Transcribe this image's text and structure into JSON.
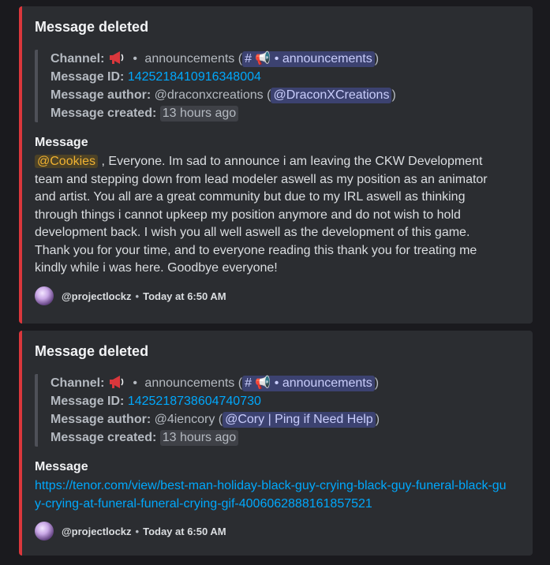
{
  "colors": {
    "accent_bar": "#da373c",
    "embed_bg": "#2b2d31",
    "link": "#00a8fc",
    "mention_bg": "#3c4270"
  },
  "messages": [
    {
      "title": "Message deleted",
      "channel_label": "Channel:",
      "channel_name": "announcements",
      "channel_mention": "announcements",
      "message_id_label": "Message ID:",
      "message_id": "1425218410916348004",
      "author_label": "Message author:",
      "author_username": "@draconxcreations",
      "author_mention": "@DraconXCreations",
      "created_label": "Message created:",
      "created_value": "13 hours ago",
      "content_label": "Message",
      "role_mention": "@Cookies",
      "content": ", Everyone. Im sad to announce i am leaving the CKW Development team and stepping down from lead modeler aswell as my position as an animator and artist. You all are a great community but due to my IRL aswell as thinking through things i cannot upkeep my position anymore and do not wish to hold development back. I wish you all well aswell as the development of this game. Thank you for your time, and to everyone reading this thank you for treating me kindly while i was here. Goodbye everyone!",
      "footer_user": "@projectlockz",
      "footer_time": "Today at 6:50 AM"
    },
    {
      "title": "Message deleted",
      "channel_label": "Channel:",
      "channel_name": "announcements",
      "channel_mention": "announcements",
      "message_id_label": "Message ID:",
      "message_id": "1425218738604740730",
      "author_label": "Message author:",
      "author_username": "@4iencory",
      "author_mention": "@Cory | Ping if Need Help",
      "created_label": "Message created:",
      "created_value": "13 hours ago",
      "content_label": "Message",
      "content_link": "https://tenor.com/view/best-man-holiday-black-guy-crying-black-guy-funeral-black-guy-crying-at-funeral-funeral-crying-gif-4006062888161857521",
      "footer_user": "@projectlockz",
      "footer_time": "Today at 6:50 AM"
    }
  ],
  "icons": [
    "megaphone-icon",
    "hash-icon",
    "avatar"
  ]
}
